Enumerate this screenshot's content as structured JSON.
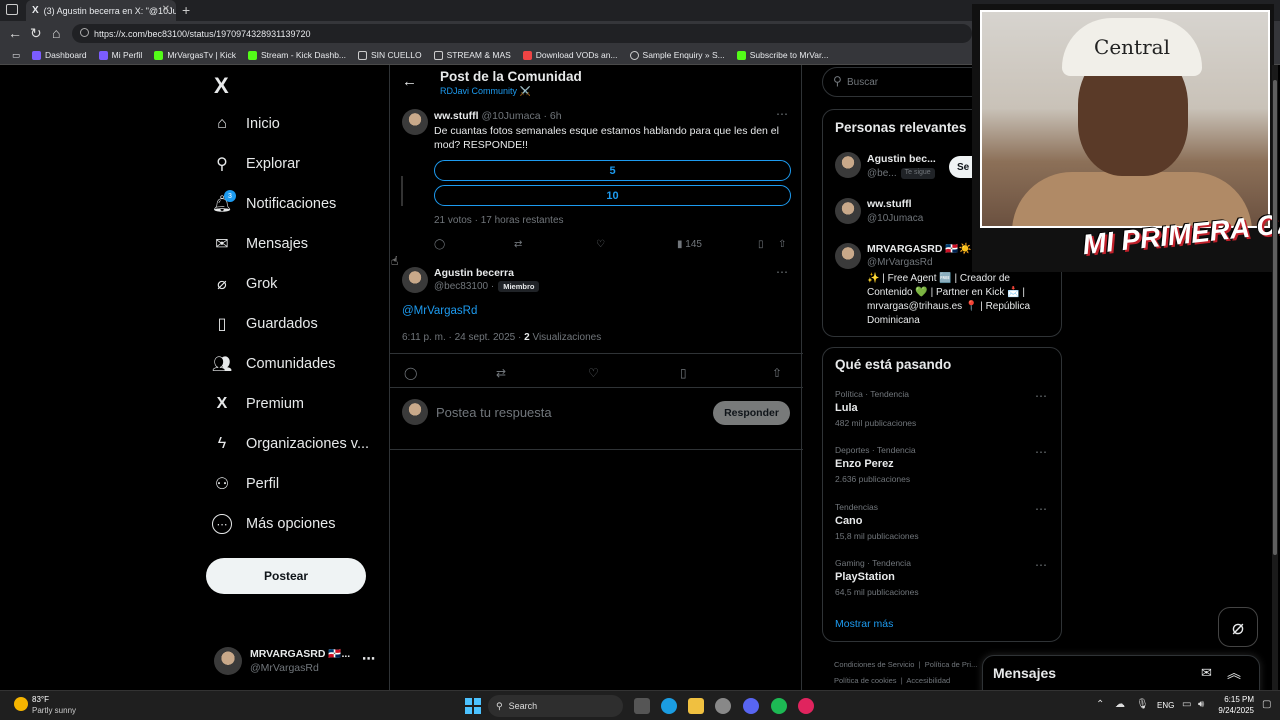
{
  "browser": {
    "tab_title": "(3) Agustin becerra en X: \"@10Ju...",
    "url": "https://x.com/bec83100/status/1970974328931139720",
    "bookmarks": [
      "Dashboard",
      "Mi Perfil",
      "MrVargasTv | Kick",
      "Stream - Kick Dashb...",
      "SIN CUELLO",
      "STREAM & MAS",
      "Download VODs an...",
      "Sample Enquiry » S...",
      "Subscribe to MrVar..."
    ]
  },
  "nav": {
    "logo": "X",
    "items": [
      {
        "label": "Inicio",
        "icon": "home-icon",
        "glyph": "⌂"
      },
      {
        "label": "Explorar",
        "icon": "search-icon",
        "glyph": "⚲"
      },
      {
        "label": "Notificaciones",
        "icon": "bell-icon",
        "glyph": "🔔︎",
        "badge": "3"
      },
      {
        "label": "Mensajes",
        "icon": "mail-icon",
        "glyph": "✉"
      },
      {
        "label": "Grok",
        "icon": "grok-icon",
        "glyph": "⌀"
      },
      {
        "label": "Guardados",
        "icon": "bookmark-icon",
        "glyph": "▯"
      },
      {
        "label": "Comunidades",
        "icon": "people-icon",
        "glyph": "👥︎"
      },
      {
        "label": "Premium",
        "icon": "x-premium-icon",
        "glyph": "X"
      },
      {
        "label": "Organizaciones v...",
        "icon": "lightning-icon",
        "glyph": "ϟ"
      },
      {
        "label": "Perfil",
        "icon": "person-icon",
        "glyph": "⚇"
      },
      {
        "label": "Más opciones",
        "icon": "more-circle-icon",
        "glyph": "⋯"
      }
    ],
    "post_button": "Postear",
    "account": {
      "name": "MRVARGASRD 🇩🇴...",
      "handle": "@MrVargasRd"
    }
  },
  "main": {
    "header_title": "Post de la Comunidad",
    "community": "RDJavi Community ⚔️",
    "parent_post": {
      "name": "ww.stuffl",
      "handle": "@10Jumaca",
      "time": "· 6h",
      "text": "De cuantas fotos semanales esque estamos hablando para que les den el mod? RESPONDE!!",
      "poll": [
        "5",
        "10"
      ],
      "poll_meta": "21 votos · 17 horas restantes",
      "views": "145"
    },
    "post": {
      "name": "Agustin becerra",
      "handle": "@bec83100 ·",
      "member_badge": "Miembro",
      "text": "@MrVargasRd",
      "timestamp": "6:11 p. m. · 24 sept. 2025 ·",
      "views_count": "2",
      "views_label": "Visualizaciones"
    },
    "reply": {
      "placeholder": "Postea tu respuesta",
      "button": "Responder"
    }
  },
  "right": {
    "search_placeholder": "Buscar",
    "relevant_title": "Personas relevantes",
    "people": [
      {
        "name": "Agustin bec...",
        "handle": "@be...",
        "badge": "Te sigue",
        "button": "Se"
      },
      {
        "name": "ww.stuffl",
        "handle": "@10Jumaca"
      },
      {
        "name": "MRVARGASRD 🇩🇴☀️",
        "handle": "@MrVargasRd",
        "bio": "✨ | Free Agent 🆓 | Creador de Contenido 💚 | Partner en Kick 📩 | mrvargas@trihaus.es 📍 | República Dominicana"
      }
    ],
    "trends_title": "Qué está pasando",
    "trends": [
      {
        "meta": "Política · Tendencia",
        "name": "Lula",
        "count": "482 mil publicaciones"
      },
      {
        "meta": "Deportes · Tendencia",
        "name": "Enzo Perez",
        "count": "2.636 publicaciones"
      },
      {
        "meta": "Tendencias",
        "name": "Cano",
        "count": "15,8 mil publicaciones"
      },
      {
        "meta": "Gaming · Tendencia",
        "name": "PlayStation",
        "count": "64,5 mil publicaciones"
      }
    ],
    "show_more": "Mostrar más",
    "footer": [
      "Condiciones de Servicio",
      "Política de Pri...",
      "Política de cookies",
      "Accesibilidad"
    ]
  },
  "webcam": {
    "cap_text": "Central",
    "brand": "MI PRIMERA CASA"
  },
  "messages_drawer": {
    "title": "Mensajes"
  },
  "taskbar": {
    "weather_temp": "83°F",
    "weather_desc": "Partly sunny",
    "search": "Search",
    "lang": "ENG",
    "time": "6:15 PM",
    "date": "9/24/2025"
  },
  "colors": {
    "accent": "#1d9bf0",
    "muted": "#71767b",
    "border": "#2f3336"
  }
}
